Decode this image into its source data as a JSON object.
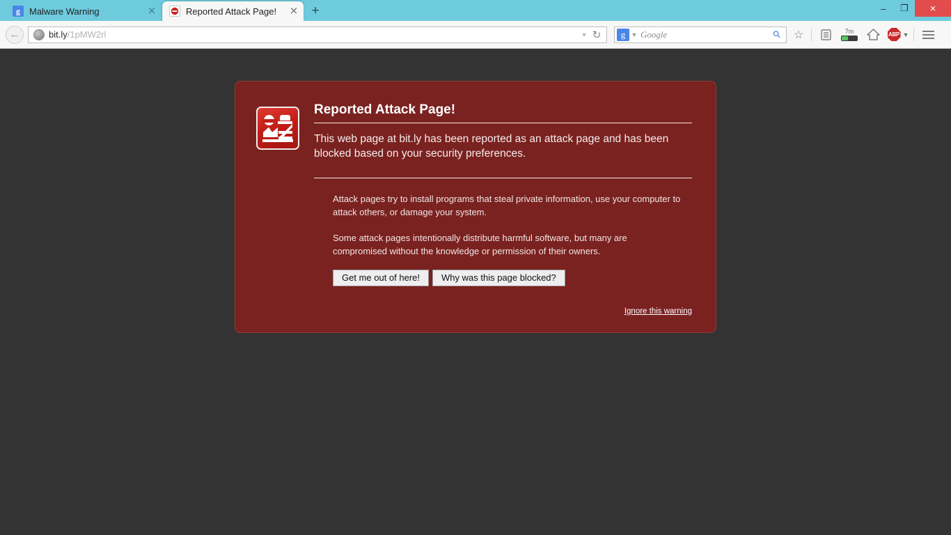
{
  "browser": {
    "tabs": [
      {
        "title": "Malware Warning",
        "favicon": "google-favicon",
        "favicon_glyph": "g",
        "active": false,
        "close_label": "×"
      },
      {
        "title": "Reported Attack Page!",
        "favicon": "blocked-favicon",
        "favicon_glyph": "⛔",
        "active": true,
        "close_label": "×"
      }
    ],
    "new_tab_label": "+",
    "window_controls": {
      "minimize": "–",
      "restore": "❐",
      "close": "×",
      "close_color": "#e24c4c"
    },
    "toolbar": {
      "back_label": "←",
      "url": {
        "host": "bit.ly",
        "path": "/1pMW2rl",
        "dropdown_label": "▼",
        "reload_label": "↻"
      },
      "search": {
        "engine_glyph": "g",
        "engine_dropdown": "▼",
        "placeholder": "Google",
        "magnifier_label": "⚲"
      },
      "icons": [
        {
          "name": "bookmark-star-icon",
          "glyph": "☆"
        },
        {
          "name": "reading-list-icon",
          "glyph": "▤"
        },
        {
          "name": "battery-icon",
          "label": "7m"
        },
        {
          "name": "home-icon",
          "glyph": "⌂"
        },
        {
          "name": "adblock-plus-icon",
          "label": "ABP",
          "caret": "▼",
          "color": "#c8282a"
        },
        {
          "name": "menu-icon",
          "label": "menu"
        }
      ]
    }
  },
  "page": {
    "icon_name": "attack-page-warning-icon",
    "title": "Reported Attack Page!",
    "lead": "This web page at bit.ly has been reported as an attack page and has been blocked based on your security preferences.",
    "paragraph_1": "Attack pages try to install programs that steal private information, use your computer to attack others, or damage your system.",
    "paragraph_2": "Some attack pages intentionally distribute harmful software, but many are compromised without the knowledge or permission of their owners.",
    "buttons": {
      "get_out": "Get me out of here!",
      "why_blocked": "Why was this page blocked?"
    },
    "ignore_link": "Ignore this warning",
    "colors": {
      "panel_background": "#7a2220",
      "page_background": "#333333",
      "text": "#f4eceb",
      "icon_red": "#c21f19"
    }
  }
}
